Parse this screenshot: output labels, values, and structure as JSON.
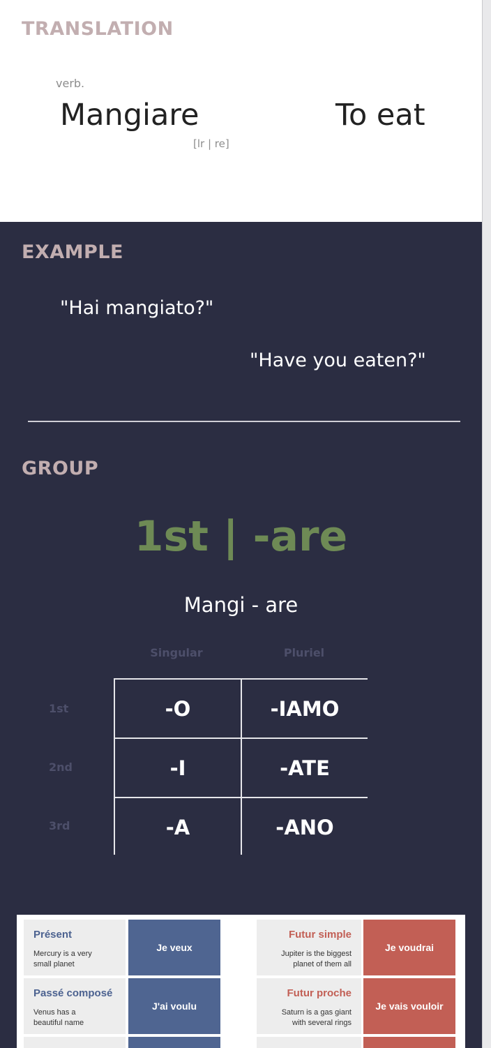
{
  "translation": {
    "heading": "TRANSLATION",
    "part_of_speech": "verb.",
    "word_italian": "Mangiare",
    "word_english": "To eat",
    "pronunciation": "[lr | re]"
  },
  "example": {
    "heading": "EXAMPLE",
    "sentence_italian": "\"Hai mangiato?\"",
    "sentence_english": "\"Have you eaten?\""
  },
  "group": {
    "heading": "GROUP",
    "label": "1st | -are",
    "stem": "Mangi - are",
    "columns": [
      "Singular",
      "Pluriel"
    ],
    "rows": [
      {
        "person": "1st",
        "singular": "-O",
        "plural": "-IAMO"
      },
      {
        "person": "2nd",
        "singular": "-I",
        "plural": "-ATE"
      },
      {
        "person": "3rd",
        "singular": "-A",
        "plural": "-ANO"
      }
    ]
  },
  "slide": {
    "colors": {
      "blue": "#4f6591",
      "red": "#c25f55"
    },
    "left_cards": [
      {
        "title": "Présent",
        "desc_line1": "Mercury is a very",
        "desc_line2": "small planet",
        "example": "Je veux"
      },
      {
        "title": "Passé composé",
        "desc_line1": "Venus has a",
        "desc_line2": "beautiful name",
        "example": "J'ai voulu"
      }
    ],
    "right_cards": [
      {
        "title": "Futur simple",
        "desc_line1": "Jupiter is the biggest",
        "desc_line2": "planet of them all",
        "example": "Je voudrai"
      },
      {
        "title": "Futur proche",
        "desc_line1": "Saturn is a gas giant",
        "desc_line2": "with several rings",
        "example": "Je vais vouloir"
      }
    ]
  }
}
